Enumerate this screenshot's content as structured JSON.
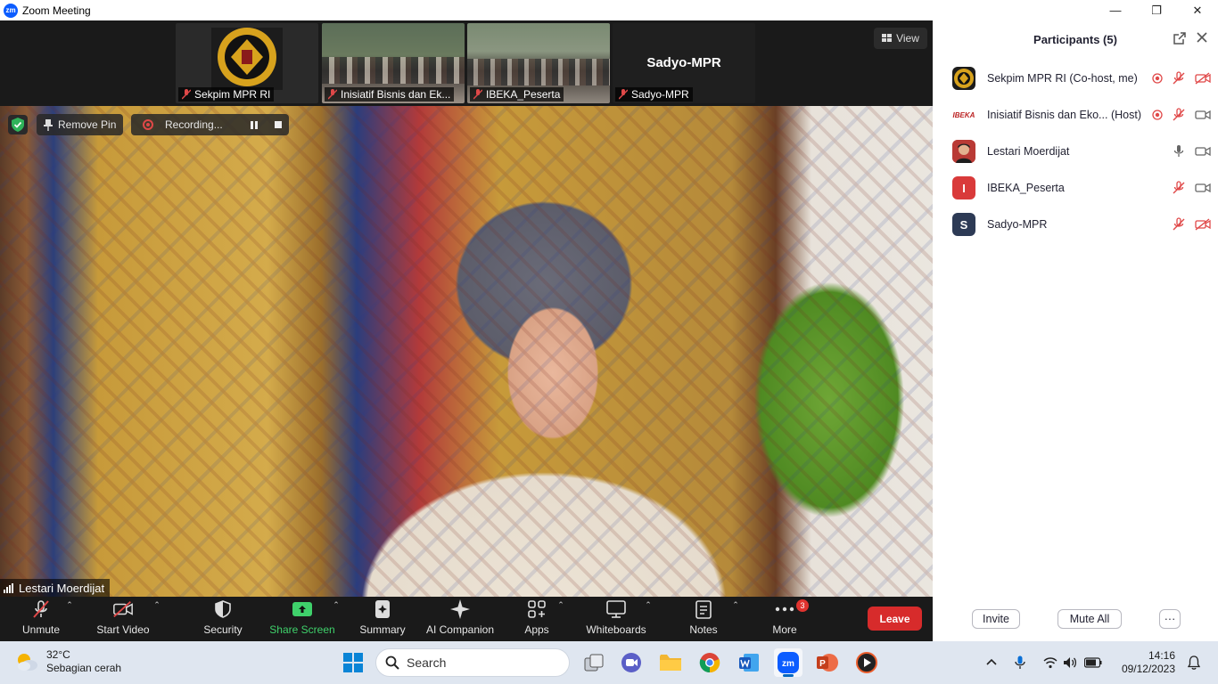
{
  "window": {
    "title": "Zoom Meeting",
    "logo_text": "zm"
  },
  "strip": {
    "thumbnails": [
      {
        "name": "Sekpim MPR RI",
        "muted": true
      },
      {
        "name": "Inisiatif Bisnis dan Ek...",
        "muted": true
      },
      {
        "name": "IBEKA_Peserta",
        "muted": true
      },
      {
        "name": "Sadyo-MPR",
        "big_label": "Sadyo-MPR",
        "muted": true
      }
    ],
    "view_label": "View"
  },
  "main": {
    "remove_pin_label": "Remove Pin",
    "recording_label": "Recording...",
    "speaker_name": "Lestari Moerdijat"
  },
  "toolbar": {
    "unmute": "Unmute",
    "start_video": "Start Video",
    "security": "Security",
    "share_screen": "Share Screen",
    "summary": "Summary",
    "ai_companion": "AI Companion",
    "apps": "Apps",
    "whiteboards": "Whiteboards",
    "notes": "Notes",
    "more": "More",
    "more_badge": "3",
    "leave": "Leave",
    "share_color": "#3fd16b",
    "leave_color": "#d72b2b"
  },
  "participants": {
    "title": "Participants (5)",
    "list": [
      {
        "name": "Sekpim MPR RI (Co-host, me)",
        "avatar": "emblem",
        "recording": true,
        "mic": "muted",
        "video": "off"
      },
      {
        "name": "Inisiatif Bisnis dan Eko... (Host)",
        "avatar": "IBEKA",
        "recording": true,
        "mic": "muted",
        "video": "on"
      },
      {
        "name": "Lestari Moerdijat",
        "avatar": "photo",
        "recording": false,
        "mic": "on",
        "video": "on"
      },
      {
        "name": "IBEKA_Peserta",
        "avatar": "I",
        "avatar_color": "#d93a3a",
        "recording": false,
        "mic": "muted",
        "video": "on"
      },
      {
        "name": "Sadyo-MPR",
        "avatar": "S",
        "avatar_color": "#2d3a55",
        "recording": false,
        "mic": "muted",
        "video": "off"
      }
    ],
    "invite": "Invite",
    "mute_all": "Mute All",
    "more_dots": "···"
  },
  "taskbar": {
    "weather_temp": "32°C",
    "weather_desc": "Sebagian cerah",
    "search_placeholder": "Search",
    "time": "14:16",
    "date": "09/12/2023"
  }
}
